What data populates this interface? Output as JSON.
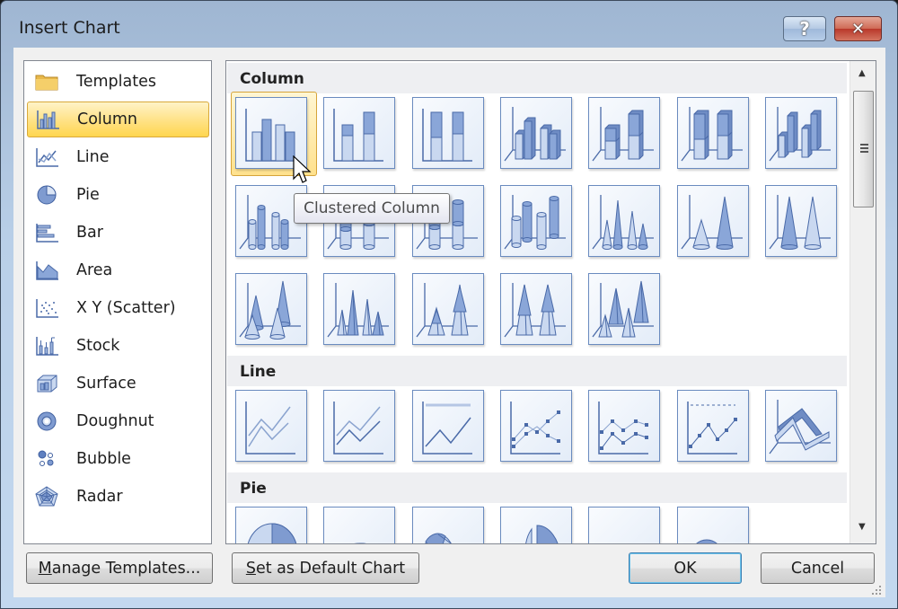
{
  "window": {
    "title": "Insert Chart",
    "help_icon": "help-icon",
    "close_icon": "close-icon",
    "help_glyph": "?",
    "close_glyph": "✕"
  },
  "chart_types": [
    {
      "label": "Templates",
      "icon": "folder-icon",
      "selected": false
    },
    {
      "label": "Column",
      "icon": "column-chart-icon",
      "selected": true
    },
    {
      "label": "Line",
      "icon": "line-chart-icon",
      "selected": false
    },
    {
      "label": "Pie",
      "icon": "pie-chart-icon",
      "selected": false
    },
    {
      "label": "Bar",
      "icon": "bar-chart-icon",
      "selected": false
    },
    {
      "label": "Area",
      "icon": "area-chart-icon",
      "selected": false
    },
    {
      "label": "X Y (Scatter)",
      "icon": "scatter-chart-icon",
      "selected": false
    },
    {
      "label": "Stock",
      "icon": "stock-chart-icon",
      "selected": false
    },
    {
      "label": "Surface",
      "icon": "surface-chart-icon",
      "selected": false
    },
    {
      "label": "Doughnut",
      "icon": "doughnut-chart-icon",
      "selected": false
    },
    {
      "label": "Bubble",
      "icon": "bubble-chart-icon",
      "selected": false
    },
    {
      "label": "Radar",
      "icon": "radar-chart-icon",
      "selected": false
    }
  ],
  "gallery": {
    "sections": [
      {
        "title": "Column",
        "subtypes": [
          "clustered-column",
          "stacked-column",
          "100-stacked-column",
          "3d-clustered-column",
          "3d-stacked-column",
          "3d-100-stacked-column",
          "3d-column",
          "clustered-cylinder",
          "stacked-cylinder",
          "100-stacked-cylinder",
          "3d-cylinder",
          "clustered-cone",
          "stacked-cone",
          "100-stacked-cone",
          "3d-cone",
          "clustered-pyramid",
          "stacked-pyramid",
          "100-stacked-pyramid",
          "3d-pyramid"
        ]
      },
      {
        "title": "Line",
        "subtypes": [
          "line",
          "stacked-line",
          "100-stacked-line",
          "line-with-markers",
          "stacked-line-with-markers",
          "100-stacked-line-with-markers",
          "3d-line"
        ]
      },
      {
        "title": "Pie",
        "subtypes": [
          "pie",
          "exploded-pie-3d",
          "pie-of-pie",
          "exploded-pie",
          "exploded-pie-3d-b",
          "bar-of-pie"
        ]
      }
    ],
    "selected_subtype": "clustered-column",
    "tooltip": "Clustered Column"
  },
  "scrollbar": {
    "up_arrow": "▲",
    "down_arrow": "▼",
    "position_fraction": 0.0
  },
  "buttons": {
    "manage_templates": {
      "mnemonic": "M",
      "rest": "anage Templates..."
    },
    "set_default": {
      "mnemonic": "S",
      "rest": "et as Default Chart"
    },
    "ok": "OK",
    "cancel": "Cancel"
  },
  "colors": {
    "selection_fill": "#ffe38a",
    "selection_border": "#d9a93a",
    "icon_blue": "#4a6aa8",
    "icon_light": "#c9d8f0"
  }
}
